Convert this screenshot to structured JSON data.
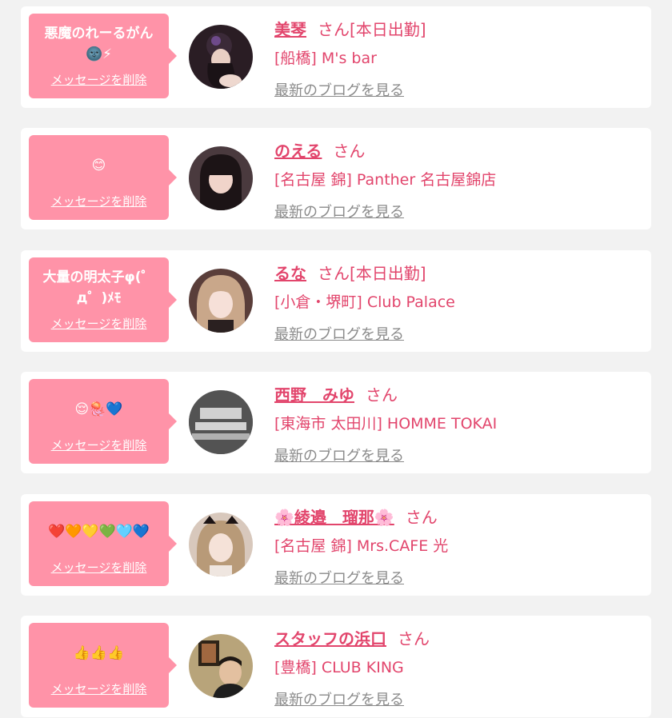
{
  "delete_label": "メッセージを削除",
  "blog_label": "最新のブログを見る",
  "san_label": "さん",
  "colors": {
    "bubble": "#ff93a8",
    "accent": "#e2456c",
    "link_gray": "#8a8a8a",
    "background": "#f2f2f2"
  },
  "entries": [
    {
      "message": "悪魔のれーるがん\n🌚⚡",
      "name": "美琴",
      "status": "[本日出勤]",
      "shop": "[船橋] M's bar",
      "avatar_icon": "profile-photo-icon"
    },
    {
      "message": "😊",
      "name": "のえる",
      "status": "",
      "shop": "[名古屋 錦] Panther 名古屋錦店",
      "avatar_icon": "profile-photo-icon"
    },
    {
      "message": "大量の明太子φ(゜\nд゜)ﾒﾓ",
      "name": "るな",
      "status": "[本日出勤]",
      "shop": "[小倉・堺町] Club Palace",
      "avatar_icon": "profile-photo-icon"
    },
    {
      "message": "😌🪼💙",
      "name": "西野　みゆ",
      "status": "",
      "shop": "[東海市 太田川] HOMME TOKAI",
      "avatar_icon": "profile-photo-icon"
    },
    {
      "message": "❤️🧡💛💚🩵💙",
      "name": "🌸綾邉　瑠那🌸",
      "status": "",
      "shop": "[名古屋 錦] Mrs.CAFE 光",
      "avatar_icon": "profile-photo-icon"
    },
    {
      "message": "👍👍👍",
      "name": "スタッフの浜口",
      "status": "",
      "shop": "[豊橋] CLUB KING",
      "avatar_icon": "profile-photo-icon"
    }
  ]
}
